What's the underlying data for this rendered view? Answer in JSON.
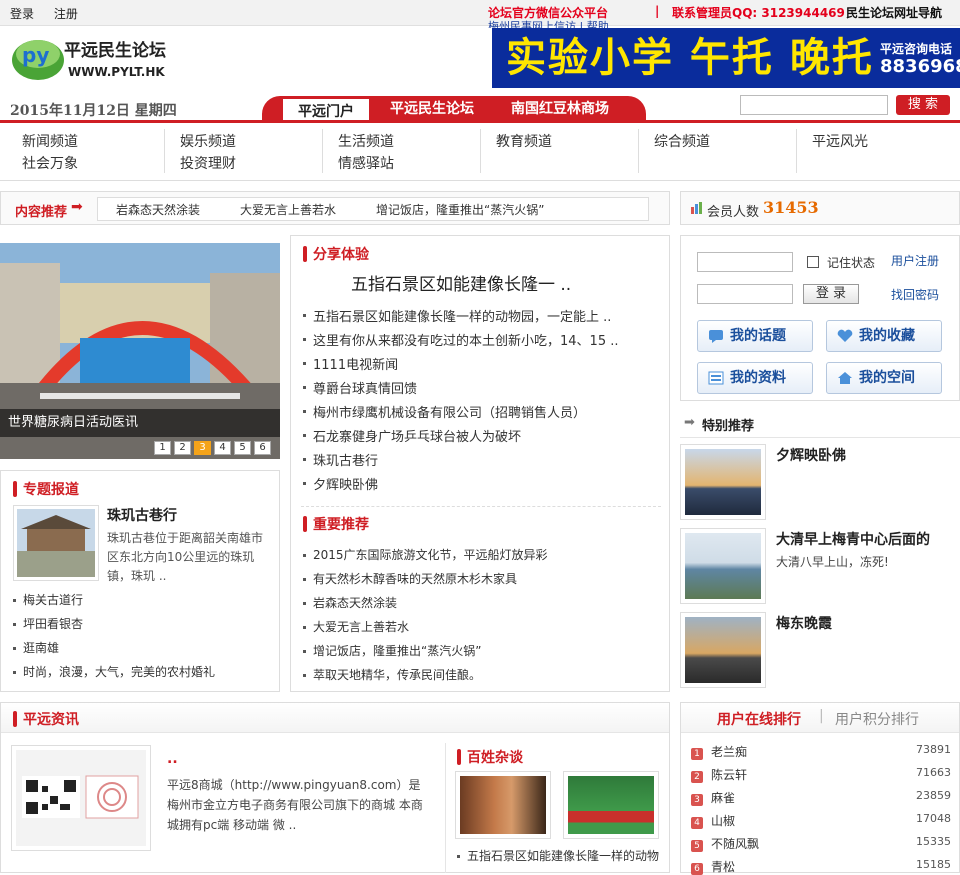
{
  "topbar": {
    "login": "登录",
    "register": "注册",
    "wechat": "论坛官方微信公众平台",
    "separator": "|",
    "qq": "联系管理员QQ: 3123944469",
    "nav": "民生论坛网址导航",
    "sub": "梅州民事网上信访  |  帮助"
  },
  "logo": {
    "name": "平远民生论坛",
    "url": "WWW.PYLT.HK",
    "mark": "py"
  },
  "banner": {
    "text": "实验小学 午托 晚托",
    "contact_label": "平远咨询电话",
    "phone": "8836968"
  },
  "header": {
    "date": "2015年11月12日  星期四",
    "tabs": [
      "平远门户",
      "平远民生论坛",
      "南国红豆林商场"
    ],
    "search_button": "搜 索",
    "search_placeholder": ""
  },
  "channels": [
    [
      "新闻频道",
      "社会万象"
    ],
    [
      "娱乐频道",
      "投资理财"
    ],
    [
      "生活频道",
      "情感驿站"
    ],
    [
      "教育频道"
    ],
    [
      "综合频道"
    ],
    [
      "平远风光"
    ]
  ],
  "recommend": {
    "label": "内容推荐",
    "arrow": "➡",
    "items": [
      "岩森态天然涂装",
      "大爱无言上善若水",
      "增记饭店，隆重推出“蒸汽火锅”"
    ]
  },
  "member": {
    "label": "会员人数",
    "count": "31453",
    "icon": "chart-icon"
  },
  "slideshow": {
    "caption": "世界糖尿病日活动医讯",
    "pages": [
      "1",
      "2",
      "3",
      "4",
      "5",
      "6"
    ],
    "active": 2
  },
  "share": {
    "title": "分享体验",
    "headline": "五指石景区如能建像长隆一 ..",
    "items": [
      "五指石景区如能建像长隆一样的动物园，一定能上 ..",
      "这里有你从来都没有吃过的本土创新小吃，14、15 ..",
      "1111电视新闻",
      "尊爵台球真情回馈",
      "梅州市绿鹰机械设备有限公司（招聘销售人员）",
      "石龙寨健身广场乒乓球台被人为破坏",
      "珠玑古巷行",
      "夕辉映卧佛"
    ]
  },
  "important": {
    "title": "重要推荐",
    "items": [
      "2015广东国际旅游文化节，平远船灯放异彩",
      "有天然杉木醇香味的天然原木杉木家具",
      "岩森态天然涂装",
      "大爱无言上善若水",
      "增记饭店，隆重推出“蒸汽火锅”",
      "萃取天地精华，传承民间佳酿。"
    ]
  },
  "topic": {
    "title": "专题报道",
    "headline": "珠玑古巷行",
    "desc": "珠玑古巷位于距离韶关南雄市区东北方向10公里远的珠玑镇，珠玑 ..",
    "items": [
      "梅关古道行",
      "坪田看银杏",
      "逛南雄",
      "时尚，浪漫，大气，完美的农村婚礼"
    ]
  },
  "login": {
    "remember": "记住状态",
    "register": "用户注册",
    "login_button": "登 录",
    "recover": "找回密码",
    "buttons": [
      {
        "label": "我的话题",
        "icon": "chat-icon"
      },
      {
        "label": "我的收藏",
        "icon": "heart-icon"
      },
      {
        "label": "我的资料",
        "icon": "profile-icon"
      },
      {
        "label": "我的空间",
        "icon": "home-icon"
      }
    ]
  },
  "special": {
    "title": "特别推荐",
    "items": [
      {
        "title": "夕辉映卧佛",
        "desc": ""
      },
      {
        "title": "大清早上梅青中心后面的",
        "desc": "大清八早上山，冻死!"
      },
      {
        "title": "梅东晚霞",
        "desc": ""
      }
    ]
  },
  "news": {
    "title": "平远资讯",
    "headline": "..",
    "desc": "平远8商城（http://www.pingyuan8.com）是梅州市金立方电子商务有限公司旗下的商城 本商城拥有pc端  移动端    微 .."
  },
  "baixing": {
    "title": "百姓杂谈",
    "items": [
      "五指石景区如能建像长隆一样的动物"
    ]
  },
  "ranking": {
    "tabs": [
      "用户在线排行",
      "用户积分排行"
    ],
    "separator": "|",
    "rows": [
      {
        "rank": "1",
        "name": "老兰痴",
        "value": "73891"
      },
      {
        "rank": "2",
        "name": "陈云轩",
        "value": "71663"
      },
      {
        "rank": "3",
        "name": "麻雀",
        "value": "23859"
      },
      {
        "rank": "4",
        "name": "山椒",
        "value": "17048"
      },
      {
        "rank": "5",
        "name": "不随风飘",
        "value": "15335"
      },
      {
        "rank": "6",
        "name": "青松",
        "value": "15185"
      }
    ]
  }
}
